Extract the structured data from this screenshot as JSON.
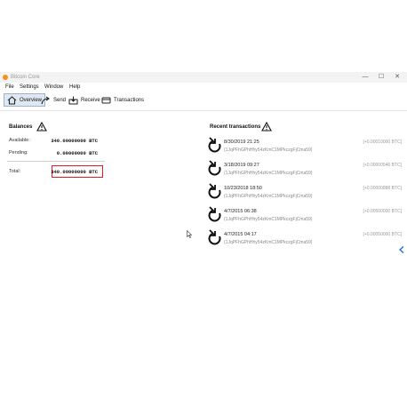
{
  "window": {
    "title": "Bitcoin Core"
  },
  "window_controls": {
    "minimize": "—",
    "maximize": "☐",
    "close": "✕"
  },
  "menu": [
    "File",
    "Settings",
    "Window",
    "Help"
  ],
  "tabs": [
    {
      "label": "Overview",
      "icon": "home-icon",
      "active": true
    },
    {
      "label": "Send",
      "icon": "send-icon",
      "active": false
    },
    {
      "label": "Receive",
      "icon": "receive-icon",
      "active": false
    },
    {
      "label": "Transactions",
      "icon": "transactions-icon",
      "active": false
    }
  ],
  "balances": {
    "title": "Balances",
    "available_label": "Available:",
    "available_value": "340.00000000 BTC",
    "pending_label": "Pending:",
    "pending_value": "0.00000000 BTC",
    "total_label": "Total:",
    "total_value": "340.00000000 BTC",
    "highlight_color": "#e02020"
  },
  "recent": {
    "title": "Recent transactions",
    "items": [
      {
        "date": "8/30/2019 21:25",
        "address": "(1JqPFhGPhHhy54zKmC1MPkczgFjCma59)",
        "amount": "[+0.00010000 BTC]"
      },
      {
        "date": "3/18/2019 09:27",
        "address": "(1JqPFhGPhHhy54zKmC1MPkczgFjCma59)",
        "amount": "[+0.00000546 BTC]"
      },
      {
        "date": "10/23/2018 18:50",
        "address": "(1JqPFhGPhHhy54zKmC1MPkczgFjCma59)",
        "amount": "[+0.00000888 BTC]"
      },
      {
        "date": "4/7/2015 06:38",
        "address": "(1JqPFhGPhHhy54zKmC1MPkczgFjCma59)",
        "amount": "[+0.00500000 BTC]"
      },
      {
        "date": "4/7/2015 04:17",
        "address": "(1JqPFhGPhHhy54zKmC1MPkczgFjCma59)",
        "amount": "[+0.00050000 BTC]"
      }
    ]
  }
}
